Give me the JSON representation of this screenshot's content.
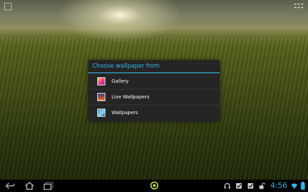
{
  "dialog": {
    "title": "Choose wallpaper from",
    "options": [
      {
        "label": "Gallery",
        "icon": "gallery-icon"
      },
      {
        "label": "Live Wallpapers",
        "icon": "live-wallpapers-icon"
      },
      {
        "label": "Wallpapers",
        "icon": "wallpapers-icon"
      }
    ]
  },
  "navbar": {
    "time": "4:56",
    "icons": [
      "back-icon",
      "home-icon",
      "recent-apps-icon",
      "center-notification-icon",
      "headphones-icon",
      "checkbox-notification-icon",
      "checkbox-notification-icon",
      "lock-icon",
      "wifi-icon",
      "battery-icon"
    ]
  },
  "colors": {
    "accent": "#33b5e5",
    "dialog_bg": "#252525",
    "navbar_bg": "#000000",
    "center_icon": "#c8e64a"
  }
}
